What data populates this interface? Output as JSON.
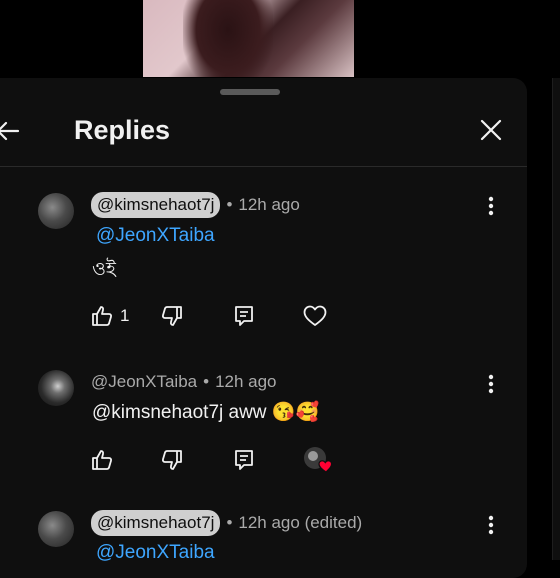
{
  "header": {
    "title": "Replies"
  },
  "comments": [
    {
      "author": "@kimsnehaot7j",
      "author_style": "chip",
      "time": "12h ago",
      "mention": "@JeonXTaiba",
      "text": "ওই",
      "like_count": "1"
    },
    {
      "author": "@JeonXTaiba",
      "author_style": "plain",
      "time": "12h ago",
      "text": "@kimsnehaot7j  aww 😘🥰",
      "like_count": ""
    },
    {
      "author": "@kimsnehaot7j",
      "author_style": "chip",
      "time": "12h ago (edited)",
      "mention": "@JeonXTaiba"
    }
  ],
  "colors": {
    "background": "#0f0f0f",
    "mention": "#3ea6ff",
    "text": "#f1f1f1",
    "muted": "#aaaaaa",
    "heart": "#ff0033"
  },
  "icons": [
    "back-arrow-icon",
    "close-icon",
    "more-vert-icon",
    "thumb-up-icon",
    "thumb-down-icon",
    "reply-icon",
    "heart-outline-icon",
    "creator-heart-icon"
  ]
}
